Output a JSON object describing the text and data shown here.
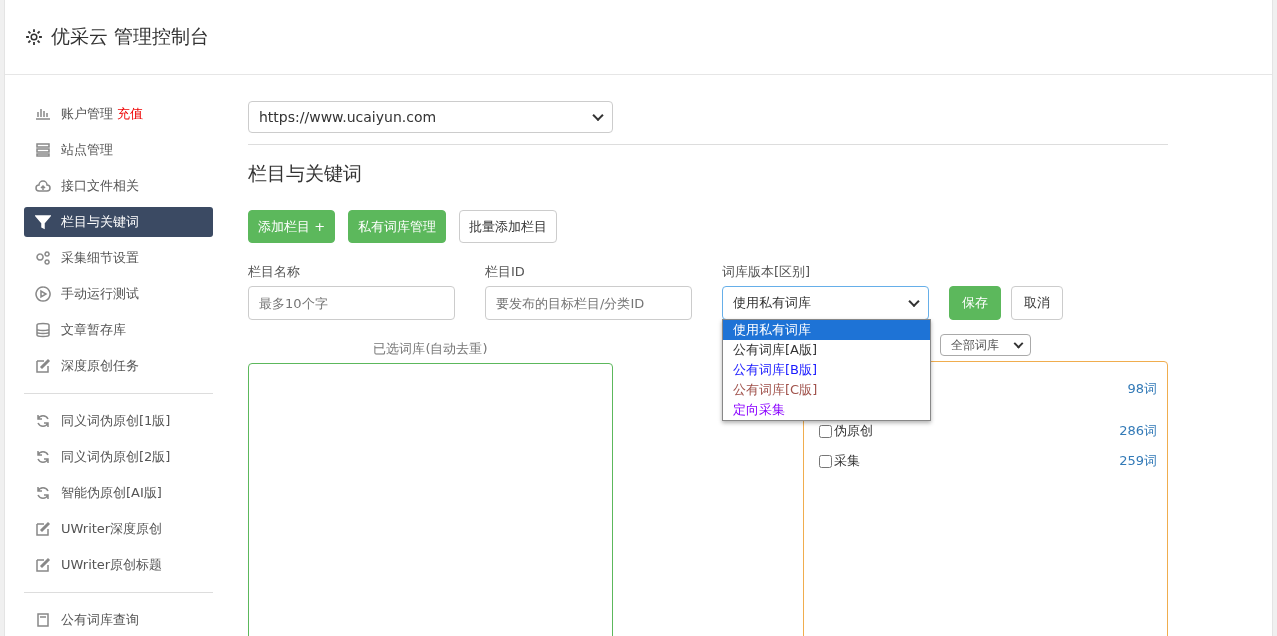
{
  "header": {
    "title": "优采云 管理控制台"
  },
  "sidebar": {
    "groups": [
      {
        "items": [
          {
            "label": "账户管理",
            "badge": "充值",
            "selected": false
          },
          {
            "label": "站点管理",
            "selected": false
          },
          {
            "label": "接口文件相关",
            "selected": false
          },
          {
            "label": "栏目与关键词",
            "selected": true
          },
          {
            "label": "采集细节设置",
            "selected": false
          },
          {
            "label": "手动运行测试",
            "selected": false
          },
          {
            "label": "文章暂存库",
            "selected": false
          },
          {
            "label": "深度原创任务",
            "selected": false
          }
        ]
      },
      {
        "items": [
          {
            "label": "同义词伪原创[1版]",
            "selected": false
          },
          {
            "label": "同义词伪原创[2版]",
            "selected": false
          },
          {
            "label": "智能伪原创[AI版]",
            "selected": false
          },
          {
            "label": "UWriter深度原创",
            "selected": false
          },
          {
            "label": "UWriter原创标题",
            "selected": false
          }
        ]
      },
      {
        "items": [
          {
            "label": "公有词库查询",
            "selected": false
          }
        ]
      }
    ]
  },
  "site_select": {
    "value": "https://www.ucaiyun.com"
  },
  "section_title": "栏目与关键词",
  "toolbar": [
    {
      "label": "添加栏目 +",
      "kind": "primary"
    },
    {
      "label": "私有词库管理",
      "kind": "primary"
    },
    {
      "label": "批量添加栏目",
      "kind": "default"
    }
  ],
  "form": {
    "name": {
      "label": "栏目名称",
      "placeholder": "最多10个字"
    },
    "id": {
      "label": "栏目ID",
      "placeholder": "要发布的目标栏目/分类ID"
    },
    "version": {
      "label": "词库版本[区别]",
      "value": "使用私有词库",
      "expanded": true,
      "options": [
        {
          "label": "使用私有词库",
          "selected": true
        },
        {
          "label": "公有词库[A版]",
          "selected": false,
          "color": "#333333"
        },
        {
          "label": "公有词库[B版]",
          "selected": false,
          "color": "#1a1aff"
        },
        {
          "label": "公有词库[C版]",
          "selected": false,
          "color": "#a0524b"
        },
        {
          "label": "定向采集",
          "selected": false,
          "color": "#8a00ff"
        }
      ]
    },
    "save": "保存",
    "cancel": "取消"
  },
  "selected_panel": {
    "label": "已选词库(自动去重)"
  },
  "library_panel": {
    "filter": "全部词库",
    "rows": [
      {
        "count": "98词"
      },
      {
        "label": "伪原创",
        "count": "286词",
        "checked": false
      },
      {
        "label": "采集",
        "count": "259词",
        "checked": false
      }
    ]
  }
}
